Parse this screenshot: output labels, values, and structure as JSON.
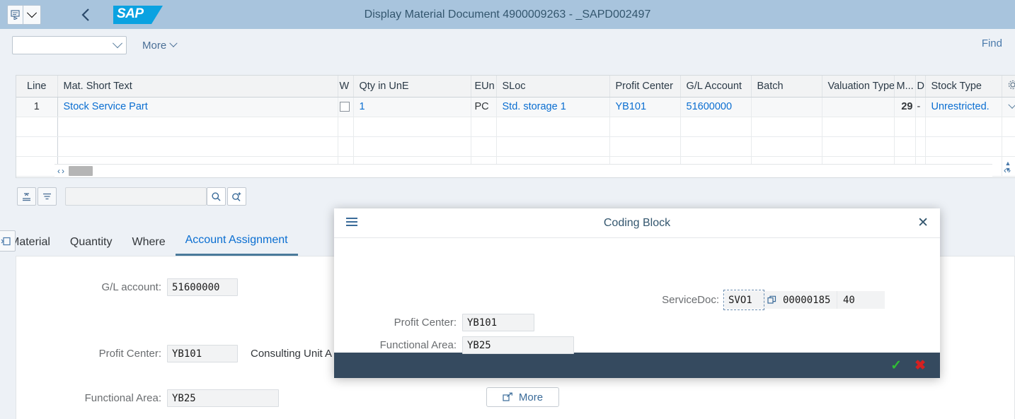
{
  "header": {
    "title": "Display Material Document 4900009263 - _SAPD002497",
    "logo_text": "SAP",
    "back_icon": "chevron-left-icon",
    "tool_icon": "form-tool-icon",
    "tool_dropdown_icon": "chevron-down-icon"
  },
  "toolbar": {
    "select_value": "",
    "select_chevron_icon": "chevron-down-icon",
    "more_label": "More",
    "more_chevron_icon": "chevron-down-icon",
    "find_label": "Find"
  },
  "table": {
    "columns": [
      {
        "label": "Line"
      },
      {
        "label": "Mat. Short Text"
      },
      {
        "label": "W"
      },
      {
        "label": "Qty in UnE"
      },
      {
        "label": "EUn"
      },
      {
        "label": "SLoc"
      },
      {
        "label": "Profit Center"
      },
      {
        "label": "G/L Account"
      },
      {
        "label": "Batch"
      },
      {
        "label": "Valuation Type"
      },
      {
        "label": "M..."
      },
      {
        "label": "D"
      },
      {
        "label": "Stock Type"
      }
    ],
    "settings_icon": "gear-icon",
    "rows": [
      {
        "line": "1",
        "mat_short_text": "Stock Service Part",
        "w": "",
        "qty": "1",
        "eun": "PC",
        "sloc": "Std. storage 1",
        "profit_center": "YB101",
        "gl_account": "51600000",
        "batch": "",
        "valuation_type": "",
        "m": "29",
        "d": "-",
        "stock_type": "Unrestricted."
      }
    ],
    "empty_rows": 3,
    "hscroll_left_icon": "chevron-left-icon",
    "hscroll_right_icon": "chevron-right-icon"
  },
  "filterbar": {
    "sort_icon": "sort-icon",
    "filter_icon": "filter-icon",
    "search_value": "",
    "search_icon": "search-icon",
    "search_plus_icon": "search-plus-icon"
  },
  "tabs": {
    "side_icon": "expand-panel-icon",
    "items": [
      {
        "label": "Material",
        "active": false
      },
      {
        "label": "Quantity",
        "active": false
      },
      {
        "label": "Where",
        "active": false
      },
      {
        "label": "Account Assignment",
        "active": true
      }
    ]
  },
  "form": {
    "gl_account_label": "G/L account:",
    "gl_account_value": "51600000",
    "profit_center_label": "Profit Center:",
    "profit_center_value": "YB101",
    "profit_center_desc": "Consulting Unit A",
    "functional_area_label": "Functional Area:",
    "functional_area_value": "YB25",
    "more_button_label": "More",
    "more_button_icon": "open-in-new-icon"
  },
  "dialog": {
    "title": "Coding Block",
    "menu_icon": "hamburger-icon",
    "close_icon": "close-icon",
    "servicedoc_label": "ServiceDoc:",
    "servicedoc_type": "SVO1",
    "servicedoc_copy_icon": "copy-icon",
    "servicedoc_number": "00000185",
    "servicedoc_item": "40",
    "profit_center_label": "Profit Center:",
    "profit_center_value": "YB101",
    "functional_area_label": "Functional Area:",
    "functional_area_value": "YB25",
    "confirm_icon": "check-icon",
    "cancel_icon": "cross-icon"
  },
  "colors": {
    "header_bg": "#a8c4dd",
    "accent_link": "#0a6ed1",
    "footer_bg": "#354a5f",
    "confirm_green": "#2fbd34",
    "cancel_red": "#d62020",
    "sap_blue": "#0aa2e1"
  }
}
